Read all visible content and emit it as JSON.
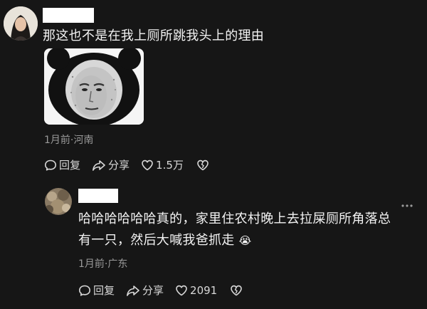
{
  "comment": {
    "text": "那这也不是在我上厕所跳我头上的理由",
    "meta": "1月前·河南",
    "actions": {
      "reply": "回复",
      "share": "分享",
      "likes": "1.5万"
    }
  },
  "reply": {
    "text_line1": "哈哈哈哈哈哈真的，家里住农村晚上去拉屎厕所角落总",
    "text_line2": "有一只，然后大喊我爸抓走",
    "emoji": "😭",
    "meta": "1月前·广东",
    "actions": {
      "reply": "回复",
      "share": "分享",
      "likes": "2091"
    }
  },
  "icons": {
    "reply": "speech-bubble-icon",
    "share": "share-arrow-icon",
    "like": "heart-icon",
    "dislike": "broken-heart-icon",
    "more": "more-dots-icon"
  },
  "colors": {
    "background": "#161616",
    "meta": "#9a9a9a",
    "name_box": "#ffffff"
  }
}
